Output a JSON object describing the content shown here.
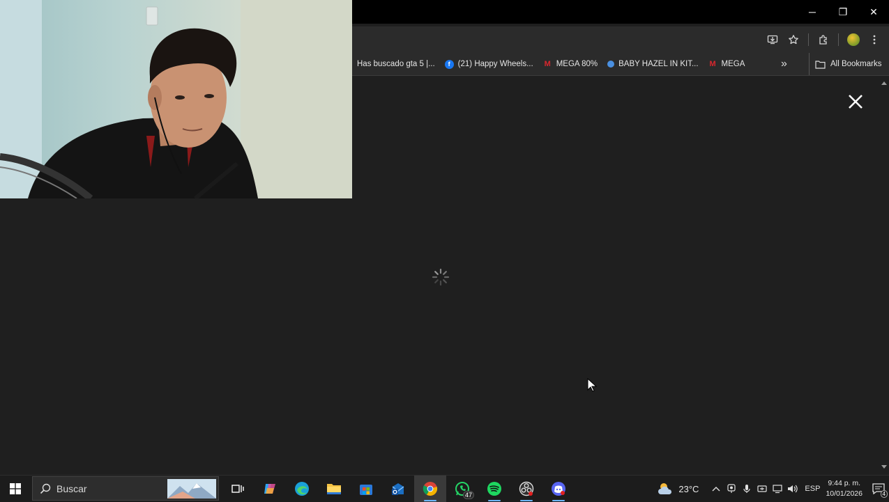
{
  "window": {
    "controls": {
      "minimize": "─",
      "restore": "❐",
      "close": "✕"
    }
  },
  "bookmarks": {
    "items": [
      {
        "label": "Has buscado gta 5 |...",
        "icon": "none"
      },
      {
        "label": "(21) Happy Wheels...",
        "icon": "facebook-icon"
      },
      {
        "label": "MEGA 80%",
        "icon": "mega-icon"
      },
      {
        "label": "BABY HAZEL IN KIT...",
        "icon": "globe-icon"
      },
      {
        "label": "MEGA",
        "icon": "mega-icon"
      }
    ],
    "more": "»",
    "all_bookmarks": "All Bookmarks"
  },
  "content": {
    "state": "loading"
  },
  "taskbar": {
    "search_placeholder": "Buscar",
    "apps": [
      {
        "name": "task-view",
        "active": false
      },
      {
        "name": "copilot",
        "active": false
      },
      {
        "name": "edge",
        "active": false
      },
      {
        "name": "file-explorer",
        "active": false
      },
      {
        "name": "microsoft-store",
        "active": false
      },
      {
        "name": "outlook",
        "active": false
      },
      {
        "name": "chrome",
        "active": true
      },
      {
        "name": "whatsapp",
        "active": false,
        "badge": "47"
      },
      {
        "name": "spotify",
        "active": false
      },
      {
        "name": "obs",
        "active": false
      },
      {
        "name": "discord",
        "active": false
      }
    ],
    "weather": "23°C",
    "language": "ESP",
    "time": "9:44 p. m.",
    "date": "10/01/2026",
    "notification_count": "4"
  },
  "colors": {
    "background": "#1f1f1f",
    "taskbar": "#1c1c1c",
    "accent": "#6cb6ff"
  }
}
